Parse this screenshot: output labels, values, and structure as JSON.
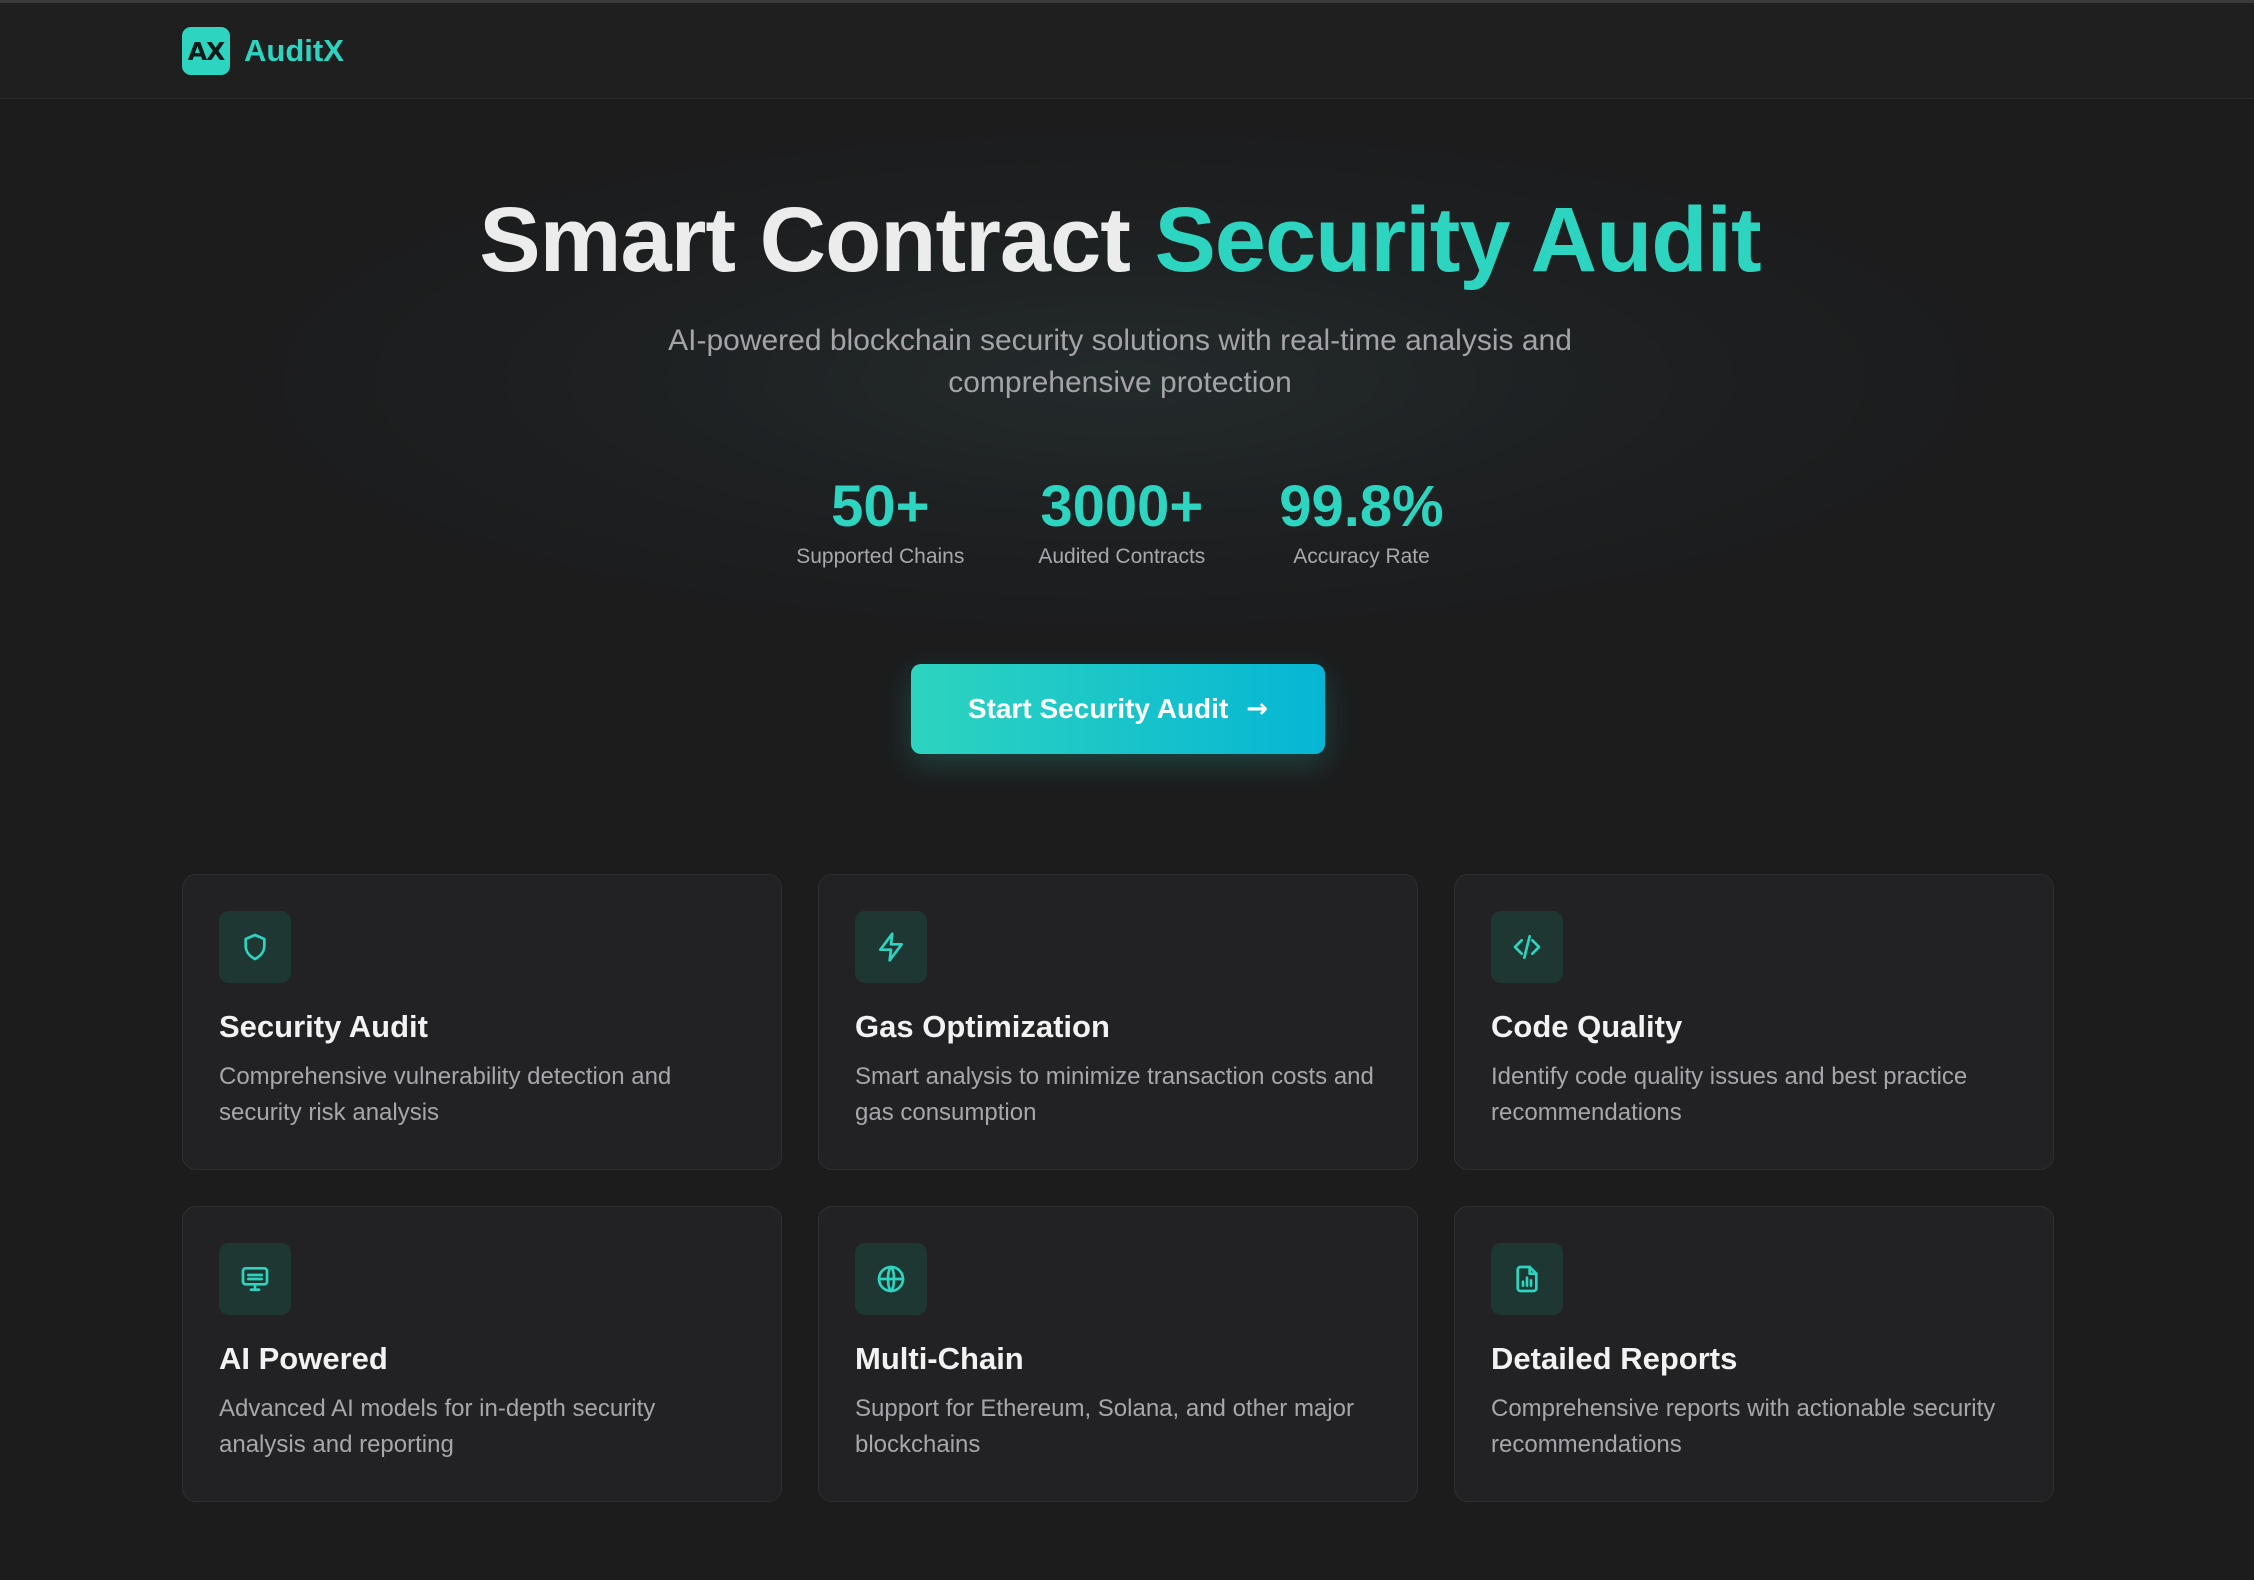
{
  "colors": {
    "accent": "#2dd4bf",
    "accent_gradient_end": "#06b6d4",
    "background": "#1c1c1d",
    "card_background": "#222224"
  },
  "header": {
    "logo_text": "AX",
    "brand_name": "AuditX"
  },
  "hero": {
    "title_plain": "Smart Contract",
    "title_accent": "Security Audit",
    "subtitle": "AI-powered blockchain security solutions with real-time analysis and comprehensive protection"
  },
  "stats": [
    {
      "value": "50+",
      "label": "Supported Chains"
    },
    {
      "value": "3000+",
      "label": "Audited Contracts"
    },
    {
      "value": "99.8%",
      "label": "Accuracy Rate"
    }
  ],
  "cta": {
    "label": "Start Security Audit",
    "icon": "arrow-right-icon"
  },
  "features": [
    {
      "icon": "shield-icon",
      "title": "Security Audit",
      "description": "Comprehensive vulnerability detection and security risk analysis"
    },
    {
      "icon": "lightning-icon",
      "title": "Gas Optimization",
      "description": "Smart analysis to minimize transaction costs and gas consumption"
    },
    {
      "icon": "code-icon",
      "title": "Code Quality",
      "description": "Identify code quality issues and best practice recommendations"
    },
    {
      "icon": "monitor-icon",
      "title": "AI Powered",
      "description": "Advanced AI models for in-depth security analysis and reporting"
    },
    {
      "icon": "globe-icon",
      "title": "Multi-Chain",
      "description": "Support for Ethereum, Solana, and other major blockchains"
    },
    {
      "icon": "report-icon",
      "title": "Detailed Reports",
      "description": "Comprehensive reports with actionable security recommendations"
    }
  ]
}
